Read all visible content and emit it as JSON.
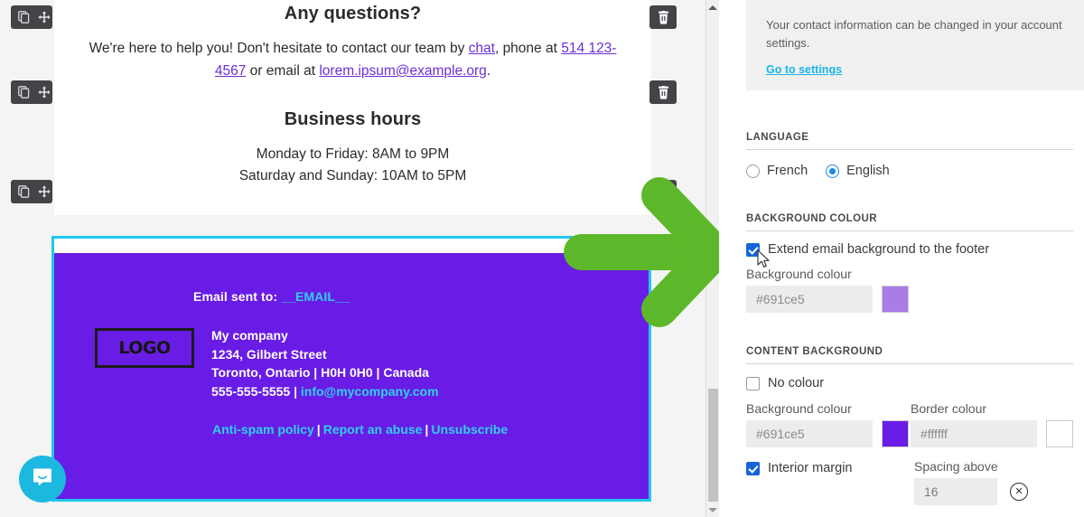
{
  "editor": {
    "email_content": {
      "heading_1": "Any questions?",
      "paragraph_1_a": "We're here to help you! Don't hesitate to contact our team by ",
      "paragraph_1_link_chat": "chat",
      "paragraph_1_b": ", phone at ",
      "paragraph_1_link_phone": "514 123-4567",
      "paragraph_1_c": " or email at ",
      "paragraph_1_link_email": "lorem.ipsum@example.org",
      "paragraph_1_d": ".",
      "heading_2": "Business hours",
      "hours_line_1": "Monday to Friday: 8AM to 9PM",
      "hours_line_2": "Saturday and Sunday: 10AM to 5PM"
    },
    "footer_block": {
      "sent_to_label": "Email sent to: ",
      "sent_to_placeholder": "__EMAIL__",
      "logo_text": "LOGO",
      "company_name": "My company",
      "address_street": "1234, Gilbert Street",
      "address_city": "Toronto, Ontario | H0H 0H0 | Canada",
      "phone": "555-555-5555",
      "separator": " | ",
      "email": "info@mycompany.com",
      "links": [
        {
          "label": "Anti-spam policy"
        },
        {
          "label": "Report an abuse"
        },
        {
          "label": "Unsubscribe"
        }
      ],
      "link_separator": "|",
      "background_colour": "#691ce5",
      "accent_colour": "#2fd0ef",
      "selection_colour": "#1ec8f0"
    },
    "block_tools": [
      {
        "duplicate_icon": "copy-icon",
        "move_icon": "move-icon",
        "delete_icon": "trash-icon"
      },
      {
        "duplicate_icon": "copy-icon",
        "move_icon": "move-icon",
        "delete_icon": "trash-icon"
      },
      {
        "duplicate_icon": "copy-icon",
        "move_icon": "move-icon",
        "delete_icon": "trash-icon"
      }
    ],
    "annotation": {
      "icon": "green-arrow-icon",
      "colour": "#5cb82a"
    },
    "chat_launcher": {
      "icon": "chat-bubble-icon",
      "colour": "#1cb8e0"
    },
    "scrollbar": {
      "up_icon": "caret-up-icon",
      "down_icon": "caret-down-icon"
    }
  },
  "settings": {
    "info_box": {
      "text": "Your contact information can be changed in your account settings.",
      "link_label": "Go to settings"
    },
    "language": {
      "title": "LANGUAGE",
      "options": [
        {
          "label": "French",
          "selected": false
        },
        {
          "label": "English",
          "selected": true
        }
      ]
    },
    "background_colour": {
      "title": "BACKGROUND COLOUR",
      "extend_checkbox_label": "Extend email background to the footer",
      "extend_checked": true,
      "field_label": "Background colour",
      "value": "#691ce5",
      "swatch_colour": "#a97ce8"
    },
    "content_background": {
      "title": "CONTENT BACKGROUND",
      "no_colour_label": "No colour",
      "no_colour_checked": false,
      "background_label": "Background colour",
      "background_value": "#691ce5",
      "background_swatch": "#691ce5",
      "border_label": "Border colour",
      "border_value": "#ffffff",
      "border_swatch": "#ffffff",
      "interior_margin_label": "Interior margin",
      "interior_margin_checked": true,
      "spacing_above_label": "Spacing above",
      "spacing_above_value": "16",
      "clear_icon": "clear-circle-icon",
      "clear_glyph": "✕"
    }
  }
}
